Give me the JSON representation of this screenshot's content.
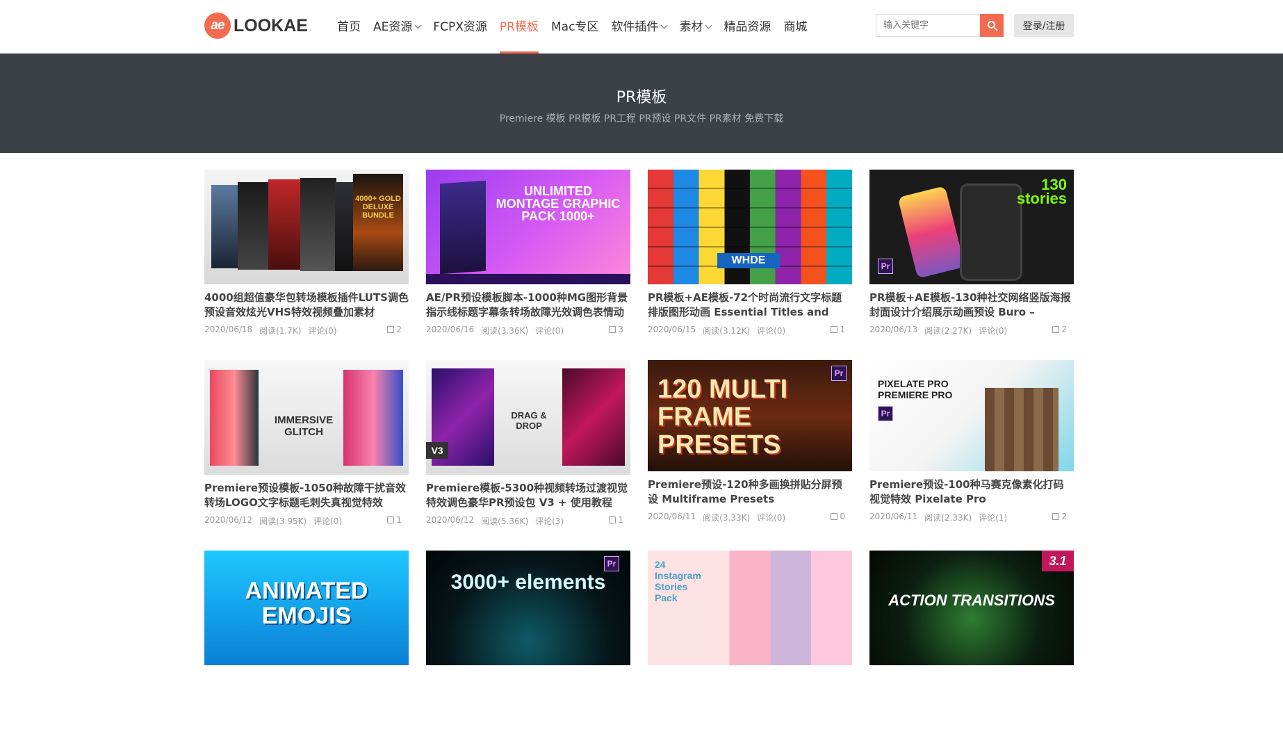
{
  "header": {
    "logo_badge": "ae",
    "logo_text": "LOOKAE",
    "nav": [
      {
        "label": "首页",
        "dropdown": false,
        "active": false
      },
      {
        "label": "AE资源",
        "dropdown": true,
        "active": false
      },
      {
        "label": "FCPX资源",
        "dropdown": false,
        "active": false
      },
      {
        "label": "PR模板",
        "dropdown": false,
        "active": true
      },
      {
        "label": "Mac专区",
        "dropdown": false,
        "active": false
      },
      {
        "label": "软件插件",
        "dropdown": true,
        "active": false
      },
      {
        "label": "素材",
        "dropdown": true,
        "active": false
      },
      {
        "label": "精品资源",
        "dropdown": false,
        "active": false
      },
      {
        "label": "商城",
        "dropdown": false,
        "active": false
      }
    ],
    "search_placeholder": "输入关键字",
    "login_label": "登录/注册"
  },
  "banner": {
    "title": "PR模板",
    "subtitle": "Premiere 模板 PR模板 PR工程 PR预设 PR文件 PR素材 免费下载"
  },
  "posts": [
    {
      "title": "4000组超值豪华包转场模板插件LUTS调色预设音效炫光VHS特效视频叠加素材",
      "date": "2020/06/18",
      "views": "阅读(1.7K)",
      "comments": "评论(0)",
      "likes": "2",
      "thumb_text": "4000+ GOLD DELUXE BUNDLE"
    },
    {
      "title": "AE/PR预设模板脚本-1000种MG图形背景指示线标题字幕条转场故障光效调色表情动",
      "date": "2020/06/16",
      "views": "阅读(3.36K)",
      "comments": "评论(0)",
      "likes": "3",
      "thumb_text": "UNLIMITED MONTAGE GRAPHIC PACK 1000+"
    },
    {
      "title": "PR模板+AE模板-72个时尚流行文字标题排版图形动画 Essential Titles and",
      "date": "2020/06/15",
      "views": "阅读(3.12K)",
      "comments": "评论(0)",
      "likes": "1",
      "thumb_text": "WHDE"
    },
    {
      "title": "PR模板+AE模板-130种社交网络竖版海报封面设计介绍展示动画预设 Buro –",
      "date": "2020/06/13",
      "views": "阅读(2.27K)",
      "comments": "评论(0)",
      "likes": "2",
      "thumb_text": "130 stories"
    },
    {
      "title": "Premiere预设模板-1050种故障干扰音效转场LOGO文字标题毛刺失真视觉特效",
      "date": "2020/06/12",
      "views": "阅读(3.95K)",
      "comments": "评论(0)",
      "likes": "1",
      "thumb_text": "IMMERSIVE GLITCH"
    },
    {
      "title": "Premiere模板-5300种视频转场过渡视觉特效调色豪华PR预设包 V3 + 使用教程",
      "date": "2020/06/12",
      "views": "阅读(5.36K)",
      "comments": "评论(3)",
      "likes": "1",
      "thumb_text": "DRAG & DROP"
    },
    {
      "title": "Premiere预设-120种多画换拼贴分屏预设 Multiframe Presets",
      "date": "2020/06/11",
      "views": "阅读(3.33K)",
      "comments": "评论(0)",
      "likes": "0",
      "thumb_text": "120 MULTI FRAME PRESETS"
    },
    {
      "title": "Premiere预设-100种马赛克像素化打码视觉特效 Pixelate Pro",
      "date": "2020/06/11",
      "views": "阅读(2.33K)",
      "comments": "评论(1)",
      "likes": "2",
      "thumb_text": "PIXELATE PRO PREMIERE PRO"
    },
    {
      "title": "",
      "date": "",
      "views": "",
      "comments": "",
      "likes": "",
      "thumb_text": "ANIMATED EMOJIS"
    },
    {
      "title": "",
      "date": "",
      "views": "",
      "comments": "",
      "likes": "",
      "thumb_text": "3000+ elements"
    },
    {
      "title": "",
      "date": "",
      "views": "",
      "comments": "",
      "likes": "",
      "thumb_text": "24 Instagram Stories Pack"
    },
    {
      "title": "",
      "date": "",
      "views": "",
      "comments": "",
      "likes": "",
      "thumb_text": "ACTION TRANSITIONS"
    }
  ],
  "colors": {
    "accent": "#f36a4f",
    "banner_bg": "#3c4147"
  }
}
